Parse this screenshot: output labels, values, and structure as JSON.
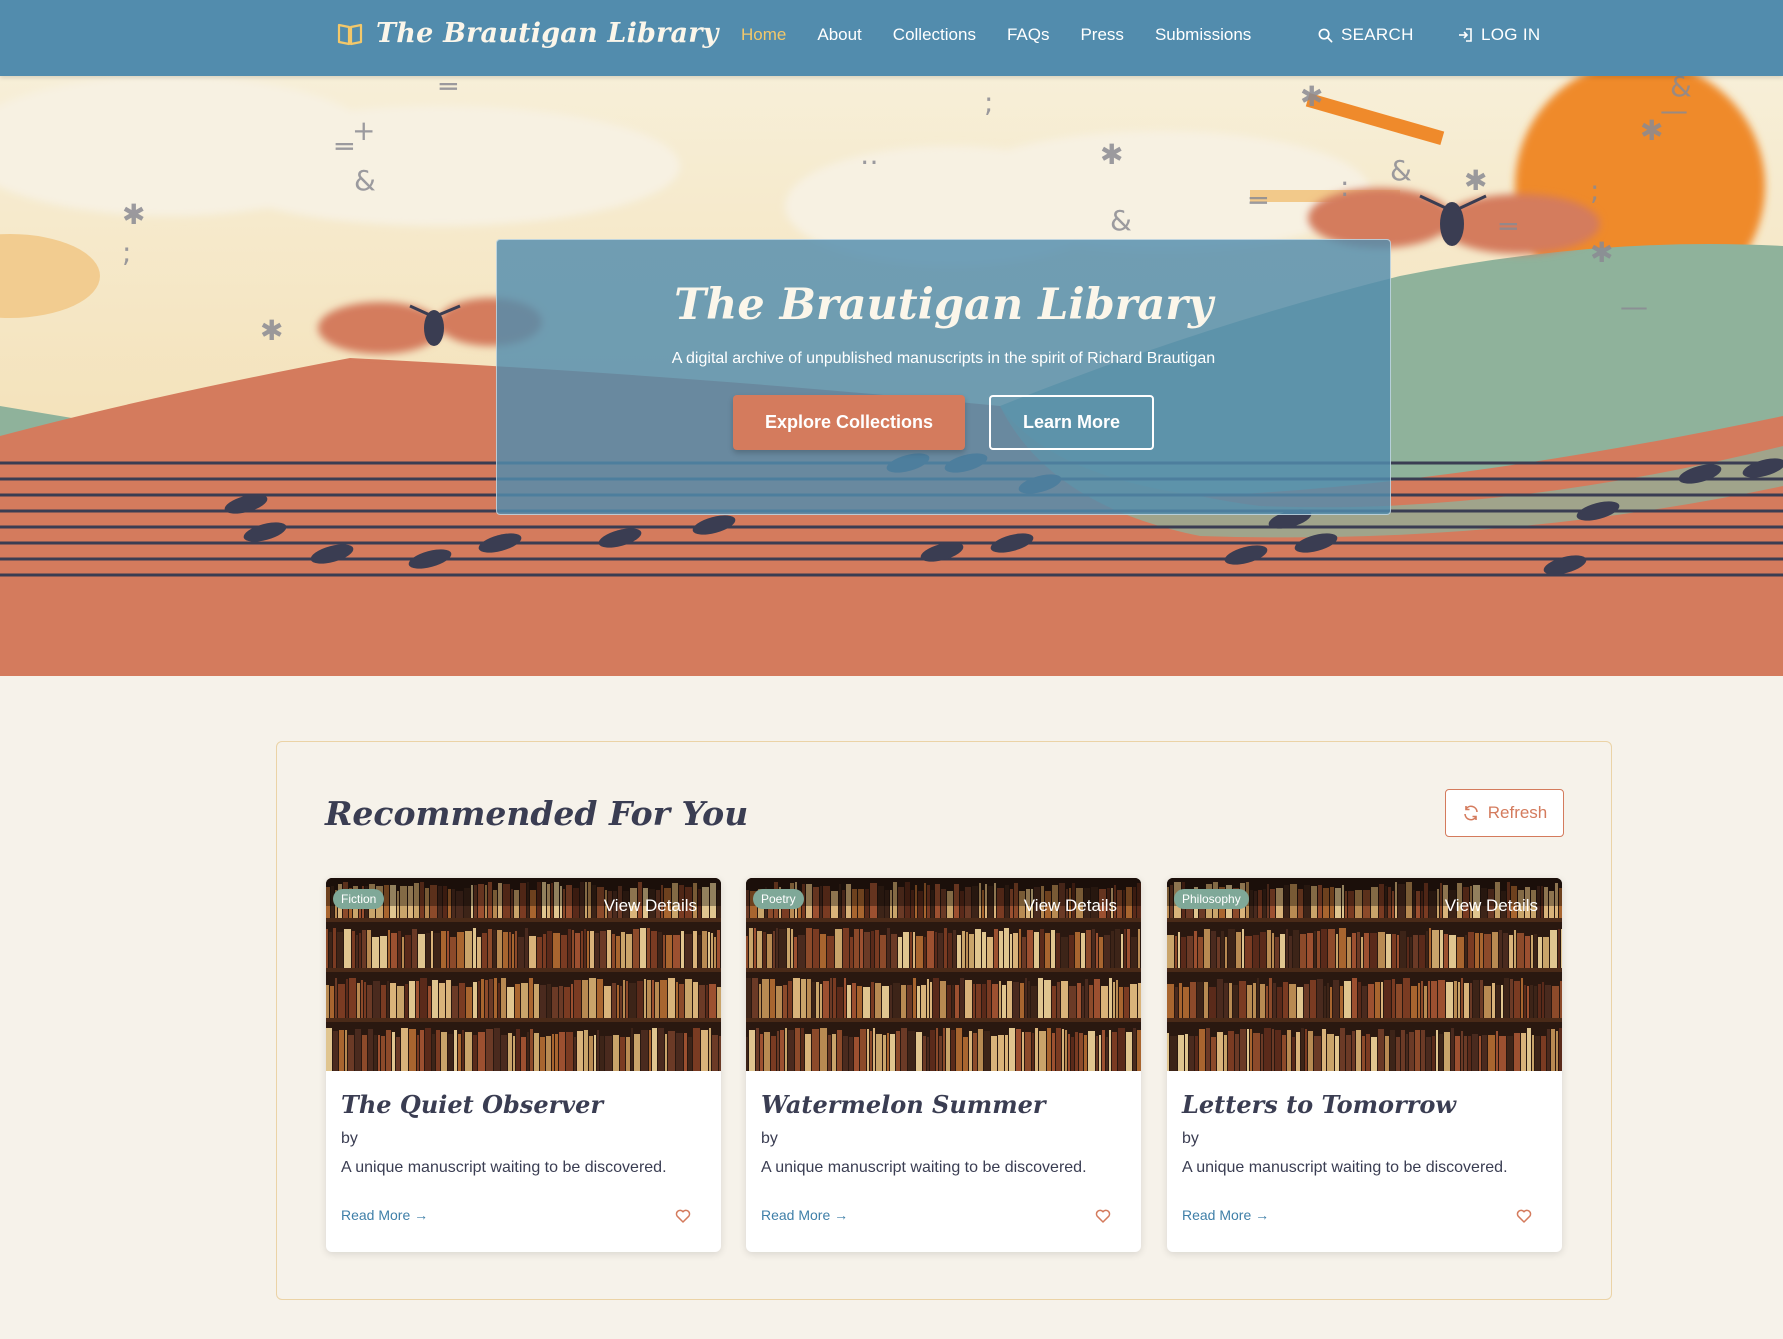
{
  "nav": {
    "brand": "The Brautigan Library",
    "links": [
      "Home",
      "About",
      "Collections",
      "FAQs",
      "Press",
      "Submissions"
    ],
    "search": "SEARCH",
    "login": "LOG IN"
  },
  "hero": {
    "title": "The Brautigan Library",
    "subtitle": "A digital archive of unpublished manuscripts in the spirit of Richard Brautigan",
    "primary_button": "Explore Collections",
    "secondary_button": "Learn More"
  },
  "recommended": {
    "title": "Recommended For You",
    "refresh": "Refresh",
    "cards": [
      {
        "badge": "Fiction",
        "view": "View Details",
        "title": "The Quiet Observer",
        "by": "by",
        "desc": "A unique manuscript waiting to be discovered.",
        "read_more": "Read More →"
      },
      {
        "badge": "Poetry",
        "view": "View Details",
        "title": "Watermelon Summer",
        "by": "by",
        "desc": "A unique manuscript waiting to be discovered.",
        "read_more": "Read More →"
      },
      {
        "badge": "Philosophy",
        "view": "View Details",
        "title": "Letters to Tomorrow",
        "by": "by",
        "desc": "A unique manuscript waiting to be discovered.",
        "read_more": "Read More →"
      }
    ]
  },
  "colors": {
    "nav": "#528cad",
    "accent": "#d47b5d",
    "active_link": "#f3c86a",
    "badge": "#7fa898"
  }
}
